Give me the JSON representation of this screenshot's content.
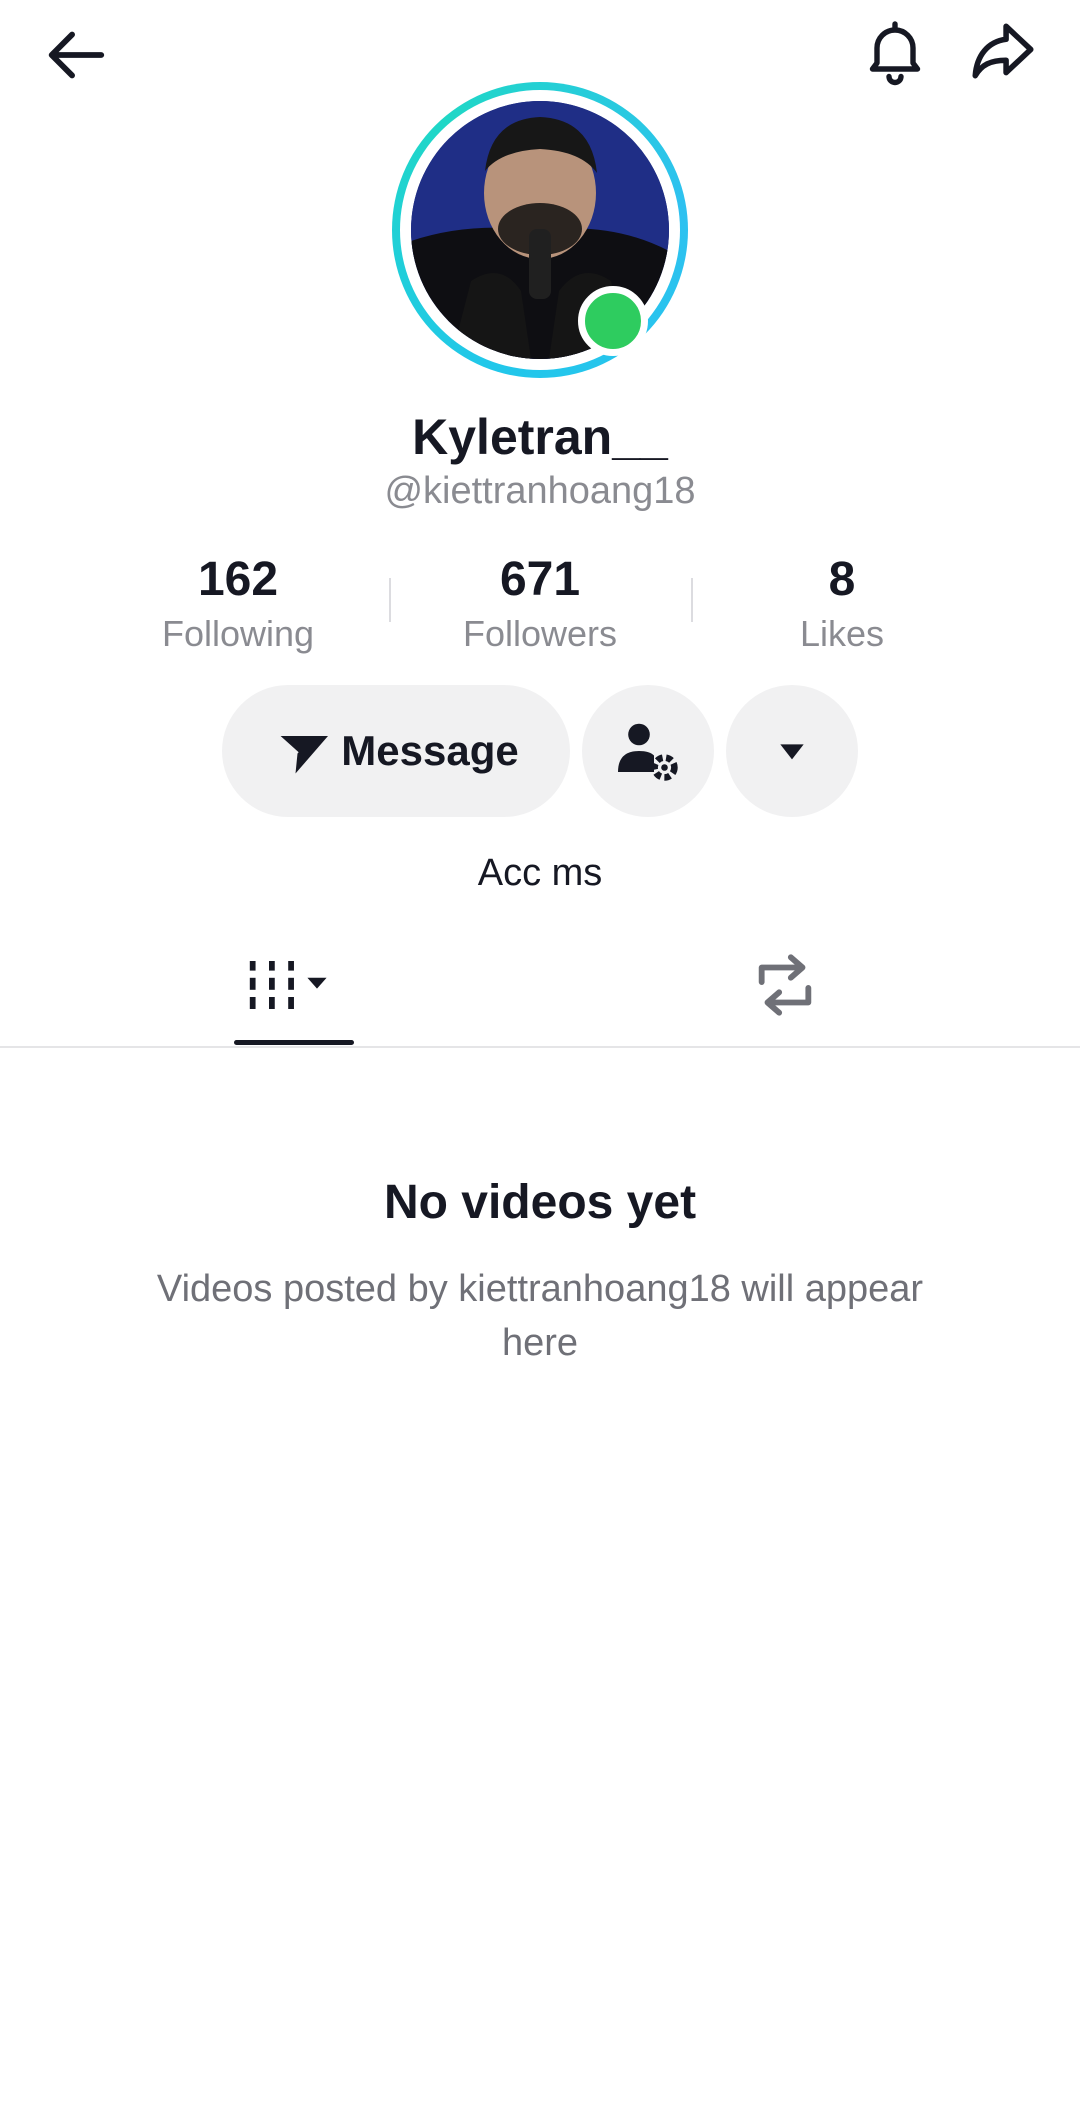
{
  "profile": {
    "display_name": "Kyletran__",
    "handle": "@kiettranhoang18",
    "bio": "Acc ms"
  },
  "stats": {
    "following": {
      "value": "162",
      "label": "Following"
    },
    "followers": {
      "value": "671",
      "label": "Followers"
    },
    "likes": {
      "value": "8",
      "label": "Likes"
    }
  },
  "actions": {
    "message_label": "Message"
  },
  "empty_state": {
    "title": "No videos yet",
    "subtitle": "Videos posted by kiettranhoang18 will appear here"
  },
  "icons": {
    "back": "arrow-left-icon",
    "notifications": "bell-icon",
    "share": "share-arrow-icon",
    "message": "send-plane-icon",
    "friend_settings": "user-gear-icon",
    "more": "caret-down-icon",
    "videos_tab": "grid-icon",
    "reposts_tab": "repost-icon"
  },
  "colors": {
    "avatar_ring": "#21c7ea",
    "online_status": "#2ecc5f",
    "button_bg": "#f1f1f2",
    "secondary_text": "#8a8b91"
  }
}
